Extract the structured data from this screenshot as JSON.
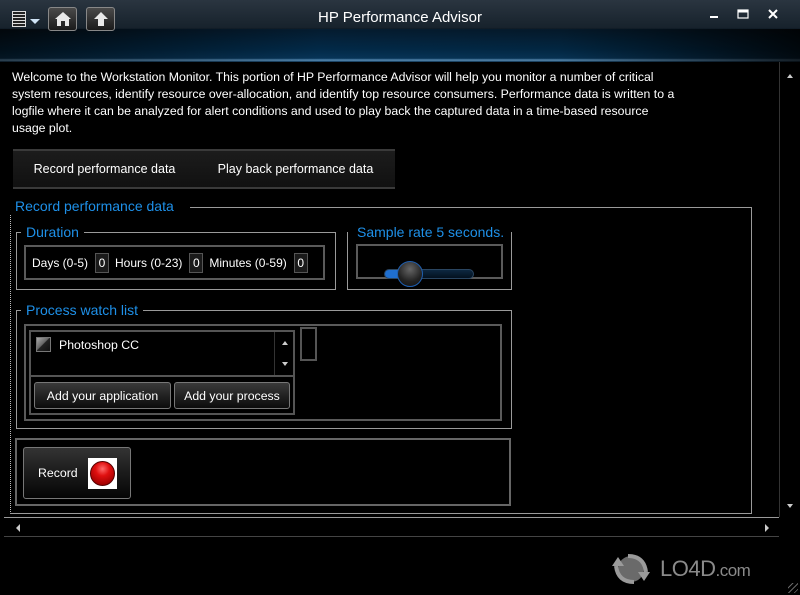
{
  "window": {
    "title": "HP Performance Advisor",
    "controls": {
      "minimize": "minimize",
      "maximize": "maximize",
      "close": "close"
    }
  },
  "toolbar": {
    "menu_icon": "menu-list-icon",
    "home_icon": "home-icon",
    "up_icon": "up-arrow-icon"
  },
  "intro": {
    "text": "Welcome to the Workstation Monitor. This portion of HP Performance Advisor will help you monitor a number of critical system resources, identify resource over-allocation, and identify top resource consumers. Performance data is written to a logfile where it can be analyzed for alert conditions and used to play back the captured data in a time-based resource usage plot."
  },
  "tabs": [
    {
      "label": "Record performance data",
      "selected": true
    },
    {
      "label": "Play back performance data",
      "selected": false
    }
  ],
  "record_section": {
    "title": "Record performance data",
    "duration": {
      "title": "Duration",
      "fields": [
        {
          "label": "Days (0-5)",
          "value": "0"
        },
        {
          "label": "Hours (0-23)",
          "value": "0"
        },
        {
          "label": "Minutes (0-59)",
          "value": "0"
        }
      ]
    },
    "sample_rate": {
      "title": "Sample rate 5 seconds.",
      "value_seconds": 5,
      "slider_fraction": 0.2
    },
    "process_watch": {
      "title": "Process watch list",
      "items": [
        {
          "label": "Photoshop CC",
          "checked": false
        }
      ],
      "add_application_label": "Add your application",
      "add_process_label": "Add your process"
    },
    "record_button": {
      "label": "Record",
      "icon": "record-icon",
      "color": "#d01010"
    }
  },
  "watermark": {
    "brand": "LO4D",
    "suffix": ".com"
  },
  "colors": {
    "accent": "#1e90e8",
    "background": "#000000"
  }
}
